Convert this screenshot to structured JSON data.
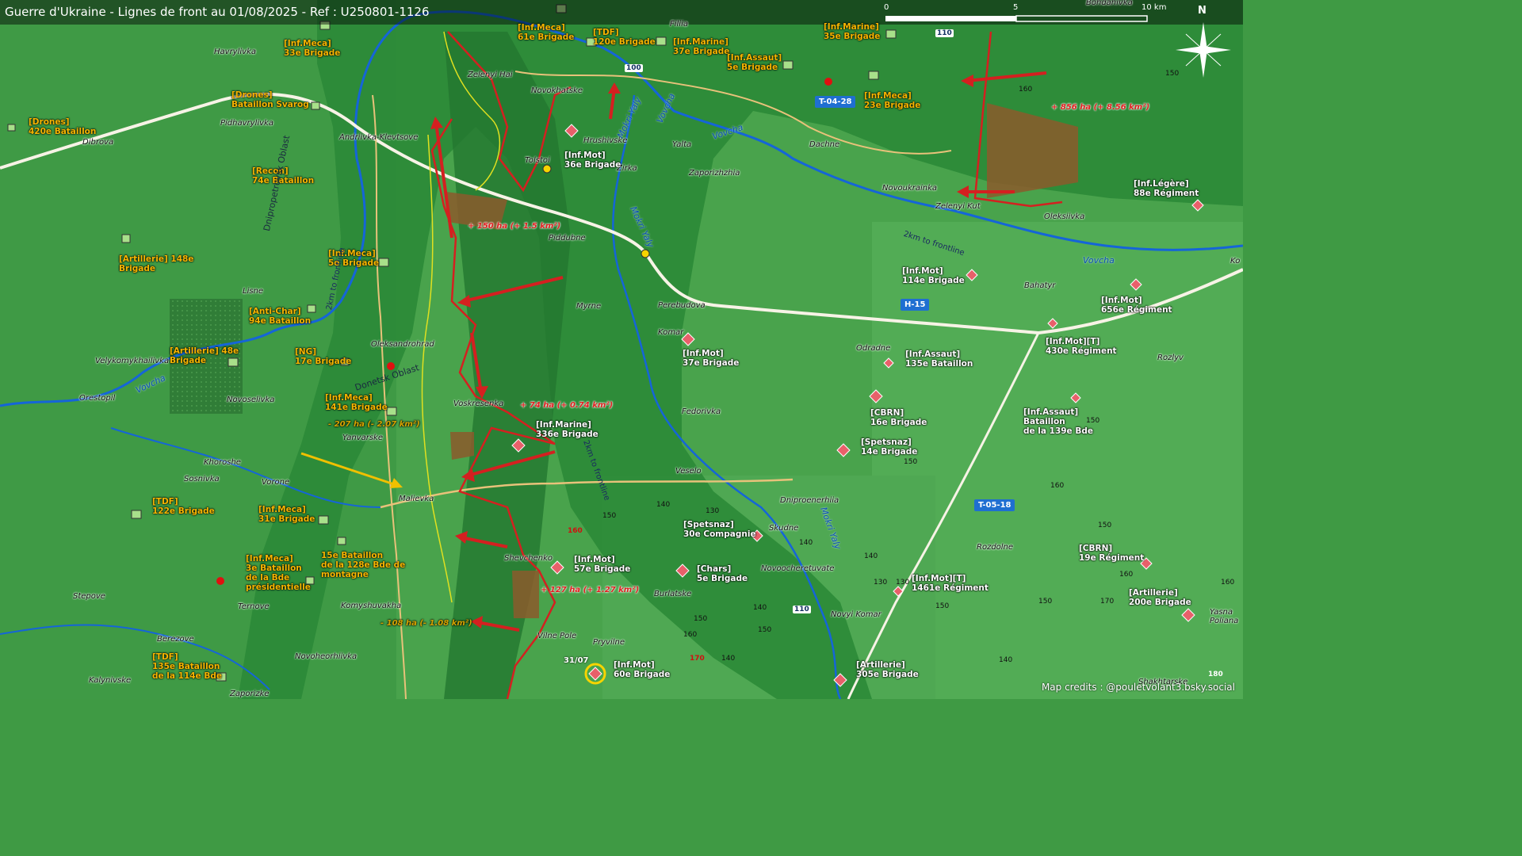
{
  "header": {
    "title": "Guerre d'Ukraine - Lignes de front au 01/08/2025 - Ref : U250801-1126"
  },
  "scale": {
    "labels": [
      "0",
      "5",
      "10 km"
    ]
  },
  "compass": {
    "label": "N"
  },
  "credits": "Map credits : @pouletvolant3.bsky.social",
  "colors": {
    "frontline": "#d42020",
    "ua_zone": "#2e8a36",
    "ru_gain": "#8b5a2b",
    "unit_label": "#f6b400",
    "road_badge": "#1f6fd1"
  },
  "towns": [
    {
      "name": "Havrylivka"
    },
    {
      "name": "Pidhavrylivka"
    },
    {
      "name": "Dibrova"
    },
    {
      "name": "Andriivka-Klevtsove"
    },
    {
      "name": "Zelenyi Hai"
    },
    {
      "name": "Novokhatske"
    },
    {
      "name": "Hrushivske"
    },
    {
      "name": "Tolstoi"
    },
    {
      "name": "Zirka"
    },
    {
      "name": "Yalta"
    },
    {
      "name": "Zaporizhzhia"
    },
    {
      "name": "Dachne"
    },
    {
      "name": "Novoukrainka"
    },
    {
      "name": "Zelenyi Kut"
    },
    {
      "name": "Oleksiivka"
    },
    {
      "name": "Piddubne"
    },
    {
      "name": "Lisne"
    },
    {
      "name": "Myrne"
    },
    {
      "name": "Perebudova"
    },
    {
      "name": "Komar"
    },
    {
      "name": "Bahatyr"
    },
    {
      "name": "Odradne"
    },
    {
      "name": "Rozlyv"
    },
    {
      "name": "Oleksandrohrad"
    },
    {
      "name": "Velykomykhailivka"
    },
    {
      "name": "Orestopil"
    },
    {
      "name": "Novoselivka"
    },
    {
      "name": "Voskresenka"
    },
    {
      "name": "Yanvarske"
    },
    {
      "name": "Fedorivka"
    },
    {
      "name": "Khoroshe"
    },
    {
      "name": "Sosnivka"
    },
    {
      "name": "Vorone"
    },
    {
      "name": "Malievka"
    },
    {
      "name": "Veselo"
    },
    {
      "name": "Dniproenerhiia"
    },
    {
      "name": "Skudne"
    },
    {
      "name": "Shevchenko"
    },
    {
      "name": "Novoocheretuvate"
    },
    {
      "name": "Burlatske"
    },
    {
      "name": "Stepove"
    },
    {
      "name": "Ternove"
    },
    {
      "name": "Komyshuvakha"
    },
    {
      "name": "Berezove"
    },
    {
      "name": "Vilne Pole"
    },
    {
      "name": "Pryvilne"
    },
    {
      "name": "Novoheorhiivka"
    },
    {
      "name": "Kalynivske"
    },
    {
      "name": "Zaporizke"
    },
    {
      "name": "Novyi Komar"
    },
    {
      "name": "Rozdolne"
    },
    {
      "name": "Shakhtarske"
    },
    {
      "name": "Yasna Poliana"
    },
    {
      "name": "Filiia"
    },
    {
      "name": "Bohdanivka"
    }
  ],
  "units": [
    {
      "lines": [
        "[Inf.Meca]",
        "33e Brigade"
      ],
      "side": "ua"
    },
    {
      "lines": [
        "[Drones]",
        "Bataillon Svarog"
      ],
      "side": "ua"
    },
    {
      "lines": [
        "[Drones]",
        "420e Bataillon"
      ],
      "side": "ua"
    },
    {
      "lines": [
        "[Recon]",
        "74e Bataillon"
      ],
      "side": "ua"
    },
    {
      "lines": [
        "[Artillerie] 148e",
        "Brigade"
      ],
      "side": "ua"
    },
    {
      "lines": [
        "[Inf.Meca]",
        "5e Brigade"
      ],
      "side": "ua"
    },
    {
      "lines": [
        "[Anti-Char]",
        "94e Bataillon"
      ],
      "side": "ua"
    },
    {
      "lines": [
        "[Artillerie] 48e",
        "Brigade"
      ],
      "side": "ua"
    },
    {
      "lines": [
        "[NG]",
        "17e Brigade"
      ],
      "side": "ua"
    },
    {
      "lines": [
        "[Inf.Meca]",
        "141e Brigade"
      ],
      "side": "ua"
    },
    {
      "lines": [
        "[TDF]",
        "122e Brigade"
      ],
      "side": "ua"
    },
    {
      "lines": [
        "[Inf.Meca]",
        "31e Brigade"
      ],
      "side": "ua"
    },
    {
      "lines": [
        "[Inf.Meca]",
        "3e Bataillon",
        "de la Bde",
        "présidentielle"
      ],
      "side": "ua"
    },
    {
      "lines": [
        "15e Bataillon",
        "de la 128e Bde de",
        "montagne"
      ],
      "side": "ua"
    },
    {
      "lines": [
        "[TDF]",
        "135e Bataillon",
        "de la 114e Bde"
      ],
      "side": "ua"
    },
    {
      "lines": [
        "[Inf.Meca]",
        "61e Brigade"
      ],
      "side": "ua"
    },
    {
      "lines": [
        "[TDF]",
        "120e Brigade"
      ],
      "side": "ua"
    },
    {
      "lines": [
        "[Inf.Marine]",
        "37e Brigade"
      ],
      "side": "ua"
    },
    {
      "lines": [
        "[Inf.Assaut]",
        "5e Brigade"
      ],
      "side": "ua"
    },
    {
      "lines": [
        "[Inf.Marine]",
        "35e Brigade"
      ],
      "side": "ua"
    },
    {
      "lines": [
        "[Inf.Meca]",
        "23e Brigade"
      ],
      "side": "ua"
    },
    {
      "lines": [
        "[Inf.Mot]",
        "36e Brigade"
      ],
      "side": "ru"
    },
    {
      "lines": [
        "[Inf.Légère]",
        "88e Régiment"
      ],
      "side": "ru"
    },
    {
      "lines": [
        "[Inf.Mot]",
        "114e Brigade"
      ],
      "side": "ru"
    },
    {
      "lines": [
        "[Inf.Mot]",
        "656e Régiment"
      ],
      "side": "ru"
    },
    {
      "lines": [
        "[Inf.Mot]",
        "37e Brigade"
      ],
      "side": "ru"
    },
    {
      "lines": [
        "[Inf.Assaut]",
        "135e Bataillon"
      ],
      "side": "ru"
    },
    {
      "lines": [
        "[Inf.Mot][T]",
        "430e Régiment"
      ],
      "side": "ru"
    },
    {
      "lines": [
        "[CBRN]",
        "16e Brigade"
      ],
      "side": "ru"
    },
    {
      "lines": [
        "[Inf.Assaut]",
        "Bataillon",
        "de la 139e Bde"
      ],
      "side": "ru"
    },
    {
      "lines": [
        "[Spetsnaz]",
        "14e Brigade"
      ],
      "side": "ru"
    },
    {
      "lines": [
        "[Inf.Marine]",
        "336e Brigade"
      ],
      "side": "ru"
    },
    {
      "lines": [
        "[Spetsnaz]",
        "30e Compagnie"
      ],
      "side": "ru"
    },
    {
      "lines": [
        "[Inf.Mot]",
        "57e Brigade"
      ],
      "side": "ru"
    },
    {
      "lines": [
        "[Chars]",
        "5e Brigade"
      ],
      "side": "ru"
    },
    {
      "lines": [
        "[CBRN]",
        "19e Régiment"
      ],
      "side": "ru"
    },
    {
      "lines": [
        "[Inf.Mot][T]",
        "1461e Régiment"
      ],
      "side": "ru"
    },
    {
      "lines": [
        "[Artillerie]",
        "200e Brigade"
      ],
      "side": "ru"
    },
    {
      "lines": [
        "[Inf.Mot]",
        "60e Brigade"
      ],
      "side": "ru"
    },
    {
      "lines": [
        "[Artillerie]",
        "305e Brigade"
      ],
      "side": "ru"
    }
  ],
  "area_changes": [
    {
      "text": "+ 856 ha (+ 8.56 km²)",
      "sign": "pos"
    },
    {
      "text": "+ 150 ha (+ 1.5 km²)",
      "sign": "pos"
    },
    {
      "text": "+ 74 ha (+ 0.74 km²)",
      "sign": "pos"
    },
    {
      "text": "- 207 ha (- 2.07 km²)",
      "sign": "neg"
    },
    {
      "text": "+ 127 ha (+ 1.27 km²)",
      "sign": "pos"
    },
    {
      "text": "- 108 ha (- 1.08 km²)",
      "sign": "neg"
    }
  ],
  "rivers": [
    "Vovcha",
    "Vovcha",
    "Vovcha",
    "Vovcha",
    "Mokri Yaly",
    "Mokri Yaly",
    "Mokri Yaly"
  ],
  "oblasts": [
    "Dnipropetrovsk Oblast",
    "Donetsk Oblast"
  ],
  "frontline_labels": [
    "2km to frontline",
    "2km to frontline",
    "2km to frontline"
  ],
  "road_badges": [
    "T-04-28",
    "H-15",
    "T-05-18"
  ],
  "road_numbers": [
    "110",
    "100",
    "110"
  ],
  "elevations": [
    "160",
    "150",
    "160",
    "150",
    "140",
    "130",
    "150",
    "140",
    "150",
    "140",
    "160",
    "150",
    "170",
    "160",
    "150",
    "150",
    "140",
    "130",
    "140",
    "150",
    "160",
    "150",
    "140",
    "130"
  ],
  "elevations_red": [
    "160",
    "170"
  ],
  "elevation_white": "180",
  "date_tag": "31/07",
  "other_text": [
    "Ko"
  ]
}
